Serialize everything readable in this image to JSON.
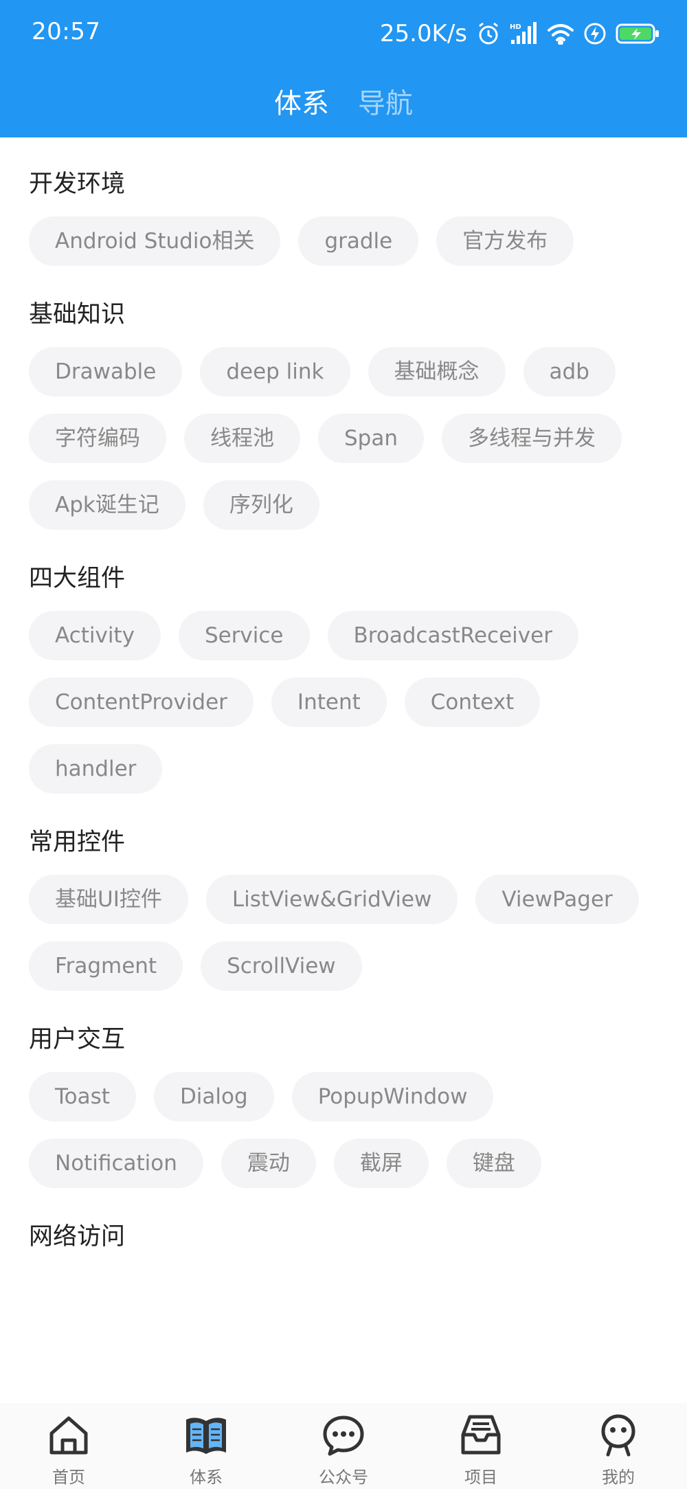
{
  "status_bar": {
    "time": "20:57",
    "net_speed": "25.0K/s",
    "icons": [
      "alarm-icon",
      "hd-signal-icon",
      "wifi-icon",
      "charging-bolt-icon",
      "battery-icon"
    ]
  },
  "tabs": [
    {
      "label": "体系",
      "active": true
    },
    {
      "label": "导航",
      "active": false
    }
  ],
  "sections": [
    {
      "title": "开发环境",
      "chips": [
        "Android Studio相关",
        "gradle",
        "官方发布"
      ]
    },
    {
      "title": "基础知识",
      "chips": [
        "Drawable",
        "deep link",
        "基础概念",
        "adb",
        "字符编码",
        "线程池",
        "Span",
        "多线程与并发",
        "Apk诞生记",
        "序列化"
      ]
    },
    {
      "title": "四大组件",
      "chips": [
        "Activity",
        "Service",
        "BroadcastReceiver",
        "ContentProvider",
        "Intent",
        "Context",
        "handler"
      ]
    },
    {
      "title": "常用控件",
      "chips": [
        "基础UI控件",
        "ListView&GridView",
        "ViewPager",
        "Fragment",
        "ScrollView"
      ]
    },
    {
      "title": "用户交互",
      "chips": [
        "Toast",
        "Dialog",
        "PopupWindow",
        "Notification",
        "震动",
        "截屏",
        "键盘"
      ]
    },
    {
      "title": "网络访问",
      "chips": []
    }
  ],
  "bottom_nav": [
    {
      "label": "首页",
      "icon": "home-icon"
    },
    {
      "label": "体系",
      "icon": "book-icon"
    },
    {
      "label": "公众号",
      "icon": "chat-bubble-icon"
    },
    {
      "label": "项目",
      "icon": "inbox-tray-icon"
    },
    {
      "label": "我的",
      "icon": "robot-face-icon"
    }
  ],
  "colors": {
    "primary": "#2196f3",
    "chip_background": "#f4f4f6",
    "chip_text": "#888888",
    "title_text": "#222222",
    "nav_icon": "#333333"
  }
}
